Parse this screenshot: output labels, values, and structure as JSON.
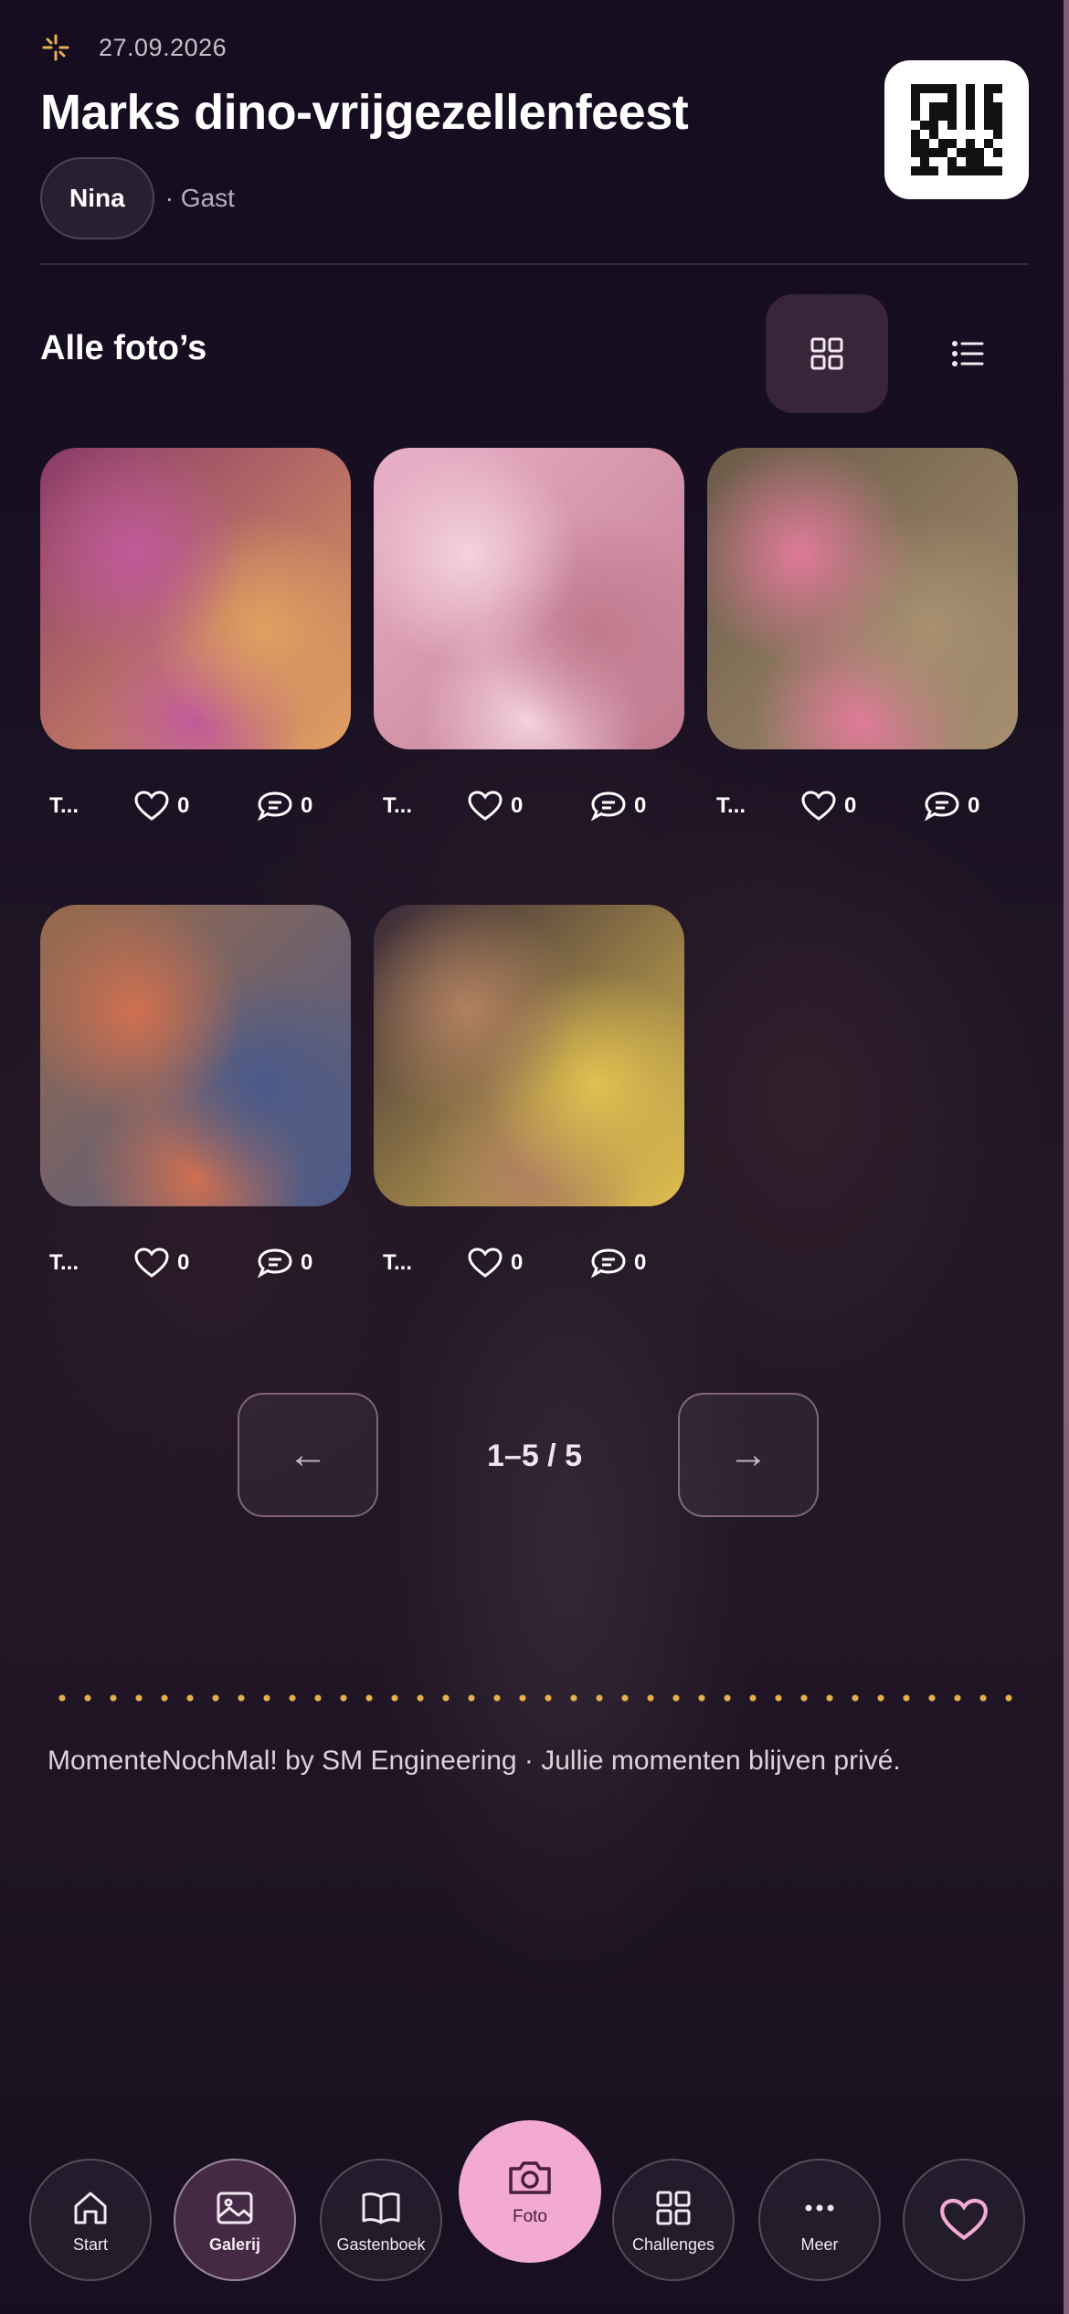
{
  "header": {
    "date": "27.09.2026",
    "title": "Marks dino-vrijgezellenfeest",
    "user_name": "Nina",
    "role": "· Gast"
  },
  "gallery": {
    "title": "Alle foto’s",
    "photos": [
      {
        "title": "T...",
        "likes": "0",
        "comments": "0",
        "colors": [
          "#8b3a6a",
          "#c05a9a",
          "#e0a060"
        ]
      },
      {
        "title": "T...",
        "likes": "0",
        "comments": "0",
        "colors": [
          "#e9b0c8",
          "#f4d2dc",
          "#c07a8e"
        ]
      },
      {
        "title": "T...",
        "likes": "0",
        "comments": "0",
        "colors": [
          "#6a5a48",
          "#e07a9a",
          "#a89070"
        ]
      },
      {
        "title": "T...",
        "likes": "0",
        "comments": "0",
        "colors": [
          "#9a6a4a",
          "#d07050",
          "#4a5a8a"
        ]
      },
      {
        "title": "T...",
        "likes": "0",
        "comments": "0",
        "colors": [
          "#3a2a3a",
          "#b08060",
          "#e0c050"
        ]
      }
    ]
  },
  "pagination": {
    "prev": "←",
    "label": "1–5 / 5",
    "next": "→"
  },
  "footer": {
    "text": "MomenteNochMal! by SM Engineering · Jullie momenten blijven privé."
  },
  "nav": {
    "start": "Start",
    "galerij": "Galerij",
    "gastenboek": "Gastenboek",
    "foto": "Foto",
    "challenges": "Challenges",
    "meer": "Meer"
  }
}
